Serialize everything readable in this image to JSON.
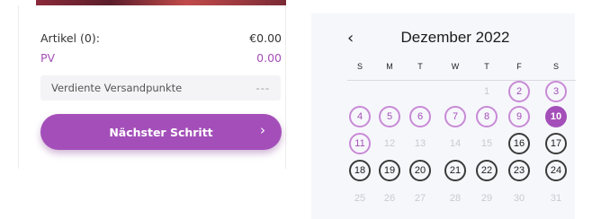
{
  "cart": {
    "items_label": "Artikel (0):",
    "items_value": "€0.00",
    "pv_label": "PV",
    "pv_value": "0.00",
    "shipping_label": "Verdiente Versandpunkte",
    "shipping_value": "---",
    "next_button_label": "Nächster Schritt",
    "next_button_arrow": "›"
  },
  "calendar": {
    "prev_arrow": "‹",
    "title": "Dezember 2022",
    "weekdays": [
      "S",
      "M",
      "T",
      "W",
      "T",
      "F",
      "S"
    ],
    "weeks": [
      [
        {
          "label": "",
          "state": "empty"
        },
        {
          "label": "",
          "state": "empty"
        },
        {
          "label": "",
          "state": "empty"
        },
        {
          "label": "",
          "state": "empty"
        },
        {
          "label": "1",
          "state": "disabled"
        },
        {
          "label": "2",
          "state": "past-avail"
        },
        {
          "label": "3",
          "state": "past-avail"
        }
      ],
      [
        {
          "label": "4",
          "state": "past-avail"
        },
        {
          "label": "5",
          "state": "past-avail"
        },
        {
          "label": "6",
          "state": "past-avail"
        },
        {
          "label": "7",
          "state": "past-avail"
        },
        {
          "label": "8",
          "state": "past-avail"
        },
        {
          "label": "9",
          "state": "past-avail"
        },
        {
          "label": "10",
          "state": "selected"
        }
      ],
      [
        {
          "label": "11",
          "state": "past-avail"
        },
        {
          "label": "12",
          "state": "disabled"
        },
        {
          "label": "13",
          "state": "disabled"
        },
        {
          "label": "14",
          "state": "disabled"
        },
        {
          "label": "15",
          "state": "disabled"
        },
        {
          "label": "16",
          "state": "future-avail"
        },
        {
          "label": "17",
          "state": "future-avail"
        }
      ],
      [
        {
          "label": "18",
          "state": "future-avail"
        },
        {
          "label": "19",
          "state": "future-avail"
        },
        {
          "label": "20",
          "state": "future-avail"
        },
        {
          "label": "21",
          "state": "future-avail"
        },
        {
          "label": "22",
          "state": "future-avail"
        },
        {
          "label": "23",
          "state": "future-avail"
        },
        {
          "label": "24",
          "state": "future-avail"
        }
      ],
      [
        {
          "label": "25",
          "state": "disabled"
        },
        {
          "label": "26",
          "state": "disabled"
        },
        {
          "label": "27",
          "state": "disabled"
        },
        {
          "label": "28",
          "state": "disabled"
        },
        {
          "label": "29",
          "state": "disabled"
        },
        {
          "label": "30",
          "state": "disabled"
        },
        {
          "label": "31",
          "state": "disabled"
        }
      ]
    ]
  },
  "colors": {
    "accent": "#a44fb9",
    "accent_light": "#c88ad6",
    "calendar_bg": "#f6f7fb",
    "disabled_text": "#c9c9cf"
  }
}
